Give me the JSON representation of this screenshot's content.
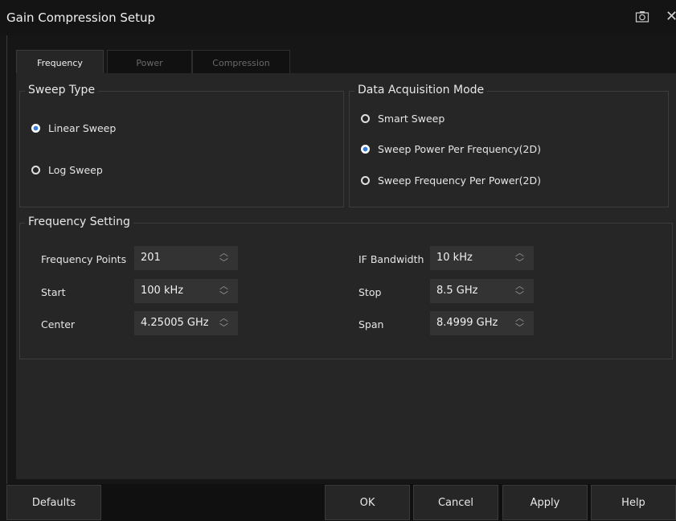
{
  "window": {
    "title": "Gain Compression Setup"
  },
  "tabs": [
    {
      "label": "Frequency",
      "active": true
    },
    {
      "label": "Power",
      "active": false
    },
    {
      "label": "Compression",
      "active": false
    }
  ],
  "sweep_type": {
    "title": "Sweep Type",
    "options": [
      {
        "label": "Linear Sweep",
        "checked": true
      },
      {
        "label": "Log Sweep",
        "checked": false
      }
    ]
  },
  "acquisition": {
    "title": "Data Acquisition Mode",
    "options": [
      {
        "label": "Smart Sweep",
        "checked": false
      },
      {
        "label": "Sweep Power Per Frequency(2D)",
        "checked": true
      },
      {
        "label": "Sweep Frequency Per Power(2D)",
        "checked": false
      }
    ]
  },
  "frequency_setting": {
    "title": "Frequency Setting",
    "fields": {
      "points": {
        "label": "Frequency Points",
        "value": "201"
      },
      "start": {
        "label": "Start",
        "value": "100 kHz"
      },
      "center": {
        "label": "Center",
        "value": "4.25005 GHz"
      },
      "ifbw": {
        "label": "IF Bandwidth",
        "value": "10 kHz"
      },
      "stop": {
        "label": "Stop",
        "value": "8.5 GHz"
      },
      "span": {
        "label": "Span",
        "value": "8.4999 GHz"
      }
    }
  },
  "buttons": {
    "defaults": "Defaults",
    "ok": "OK",
    "cancel": "Cancel",
    "apply": "Apply",
    "help": "Help"
  },
  "colors": {
    "accent": "#3a7bd5",
    "background": "#262626"
  },
  "icons": {
    "camera": "camera-icon",
    "close": "close-icon"
  }
}
